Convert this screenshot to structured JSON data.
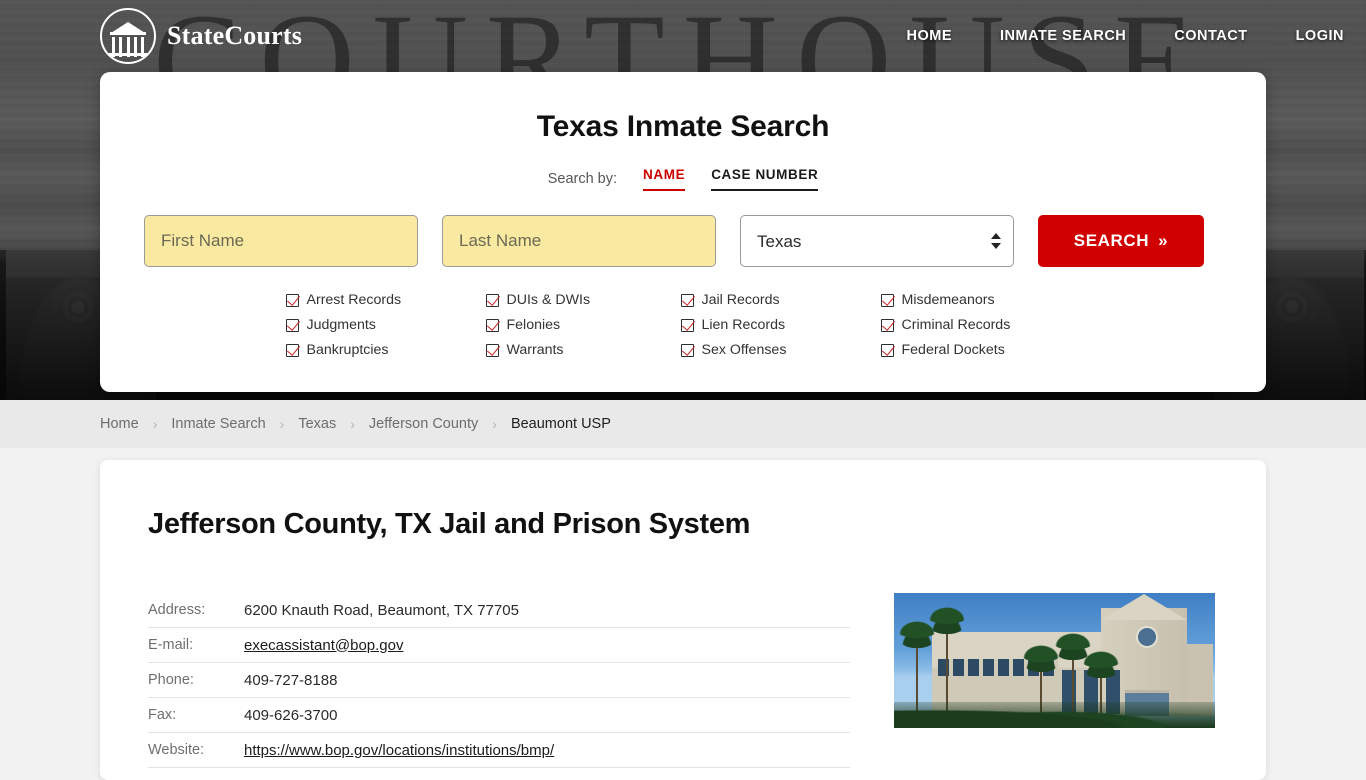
{
  "brand": {
    "name": "StateCourts",
    "logo_icon": "courthouse-circle-icon"
  },
  "nav": [
    {
      "label": "HOME"
    },
    {
      "label": "INMATE SEARCH"
    },
    {
      "label": "CONTACT"
    },
    {
      "label": "LOGIN"
    }
  ],
  "header": {
    "watermark": "COURTHOUSE"
  },
  "search": {
    "title": "Texas Inmate Search",
    "search_by_label": "Search by:",
    "tabs": [
      {
        "label": "NAME",
        "active": true
      },
      {
        "label": "CASE NUMBER",
        "active": false
      }
    ],
    "first_name": {
      "value": "",
      "placeholder": "First Name"
    },
    "last_name": {
      "value": "",
      "placeholder": "Last Name"
    },
    "state_select": {
      "value": "Texas",
      "options": [
        "Texas"
      ]
    },
    "button_label": "SEARCH",
    "button_icon": "double-chevron-right-icon",
    "button_color": "#d00000",
    "accent_color": "#c00000",
    "autofill_color": "#faeaa1",
    "categories": [
      "Arrest Records",
      "DUIs & DWIs",
      "Jail Records",
      "Misdemeanors",
      "Judgments",
      "Felonies",
      "Lien Records",
      "Criminal Records",
      "Bankruptcies",
      "Warrants",
      "Sex Offenses",
      "Federal Dockets"
    ]
  },
  "breadcrumb": [
    {
      "label": "Home",
      "current": false
    },
    {
      "label": "Inmate Search",
      "current": false
    },
    {
      "label": "Texas",
      "current": false
    },
    {
      "label": "Jefferson County",
      "current": false
    },
    {
      "label": "Beaumont USP",
      "current": true
    }
  ],
  "breadcrumb_separator": "›",
  "main": {
    "page_title": "Jefferson County, TX Jail and Prison System",
    "details": [
      {
        "key": "Address:",
        "value": "6200 Knauth Road, Beaumont, TX 77705",
        "link": false
      },
      {
        "key": "E-mail:",
        "value": "execassistant@bop.gov",
        "link": true
      },
      {
        "key": "Phone:",
        "value": "409-727-8188",
        "link": false
      },
      {
        "key": "Fax:",
        "value": "409-626-3700",
        "link": false
      },
      {
        "key": "Website:",
        "value": "https://www.bop.gov/locations/institutions/bmp/",
        "link": true
      }
    ],
    "photo_alt": "facility-administration-building-photo"
  }
}
